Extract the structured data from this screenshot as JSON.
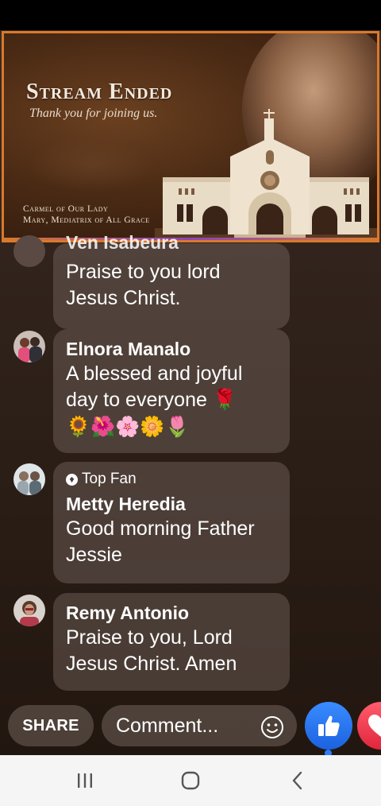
{
  "video": {
    "title": "Stream Ended",
    "subtitle": "Thank you for joining us.",
    "org_line1": "Carmel of Our Lady",
    "org_line2": "Mary, Mediatrix of All Grace"
  },
  "comments": [
    {
      "name": "Ven Isabeura",
      "text_lines": [
        "Praise to you lord",
        "Jesus Christ."
      ],
      "partial": true
    },
    {
      "name": "Elnora Manalo",
      "text_lines": [
        "A blessed and joyful",
        "day to everyone 🌹"
      ],
      "emojis": "🌻🌺🌸🌼🌷"
    },
    {
      "badge": "Top Fan",
      "name": "Metty Heredia",
      "text_lines": [
        "Good morning Father",
        "Jessie"
      ]
    },
    {
      "name": "Remy Antonio",
      "text_lines": [
        "Praise to you, Lord",
        "Jesus Christ. Amen"
      ]
    }
  ],
  "actions": {
    "share_label": "SHARE",
    "comment_placeholder": "Comment...",
    "emoji_icon": "smiley-icon",
    "like_icon": "thumbs-up-icon",
    "love_icon": "heart-icon"
  },
  "nav": {
    "recent_icon": "recent-apps-icon",
    "home_icon": "home-icon",
    "back_icon": "back-icon"
  },
  "colors": {
    "banner_border": "#d9792c",
    "like_blue": "#1b62e0",
    "love_red": "#e1263c"
  }
}
